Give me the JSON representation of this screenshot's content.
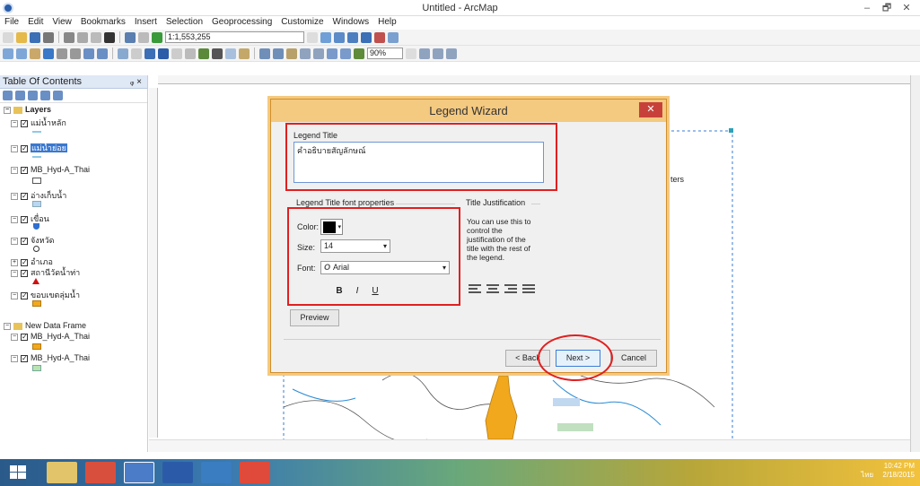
{
  "window": {
    "title": "Untitled - ArcMap",
    "min": "–",
    "max": "🗗",
    "close": "✕"
  },
  "menu": [
    "File",
    "Edit",
    "View",
    "Bookmarks",
    "Insert",
    "Selection",
    "Geoprocessing",
    "Customize",
    "Windows",
    "Help"
  ],
  "toolbar": {
    "scale": "1:1,553,255",
    "zoom": "90%"
  },
  "toc": {
    "title": "Table Of Contents",
    "pin": "ᵩ ×",
    "frame1": "Layers",
    "layers": [
      "แม่น้ำหลัก",
      "แม่น้ำย่อย",
      "MB_Hyd-A_Thai",
      "อ่างเก็บน้ำ",
      "เขื่อน",
      "จังหวัด",
      "อำเภอ",
      "สถานีวัดน้ำท่า",
      "ขอบเขตลุ่มน้ำ"
    ],
    "frame2": "New Data Frame",
    "layers2": [
      "MB_Hyd-A_Thai",
      "MB_Hyd-A_Thai"
    ]
  },
  "map": {
    "partial_text": "ters"
  },
  "dialog": {
    "title": "Legend Wizard",
    "close": "✕",
    "legend_title_label": "Legend Title",
    "legend_title_value": "คำอธิบายสัญลักษณ์",
    "font_props_label": "Legend Title font properties",
    "color_label": "Color:",
    "size_label": "Size:",
    "size_value": "14",
    "font_label": "Font:",
    "font_value": "Arial",
    "bold": "B",
    "italic": "I",
    "underline": "U",
    "justification_label": "Title Justification",
    "justification_text": "You can use this to control the justification of the title with the rest of the legend.",
    "preview": "Preview",
    "back": "< Back",
    "next": "Next >",
    "cancel": "Cancel"
  },
  "taskbar": {
    "time": "10:42 PM",
    "date": "2/18/2015",
    "lang": "ไทย"
  },
  "colors": {
    "accent": "#f4c980",
    "highlight": "#e02020"
  }
}
